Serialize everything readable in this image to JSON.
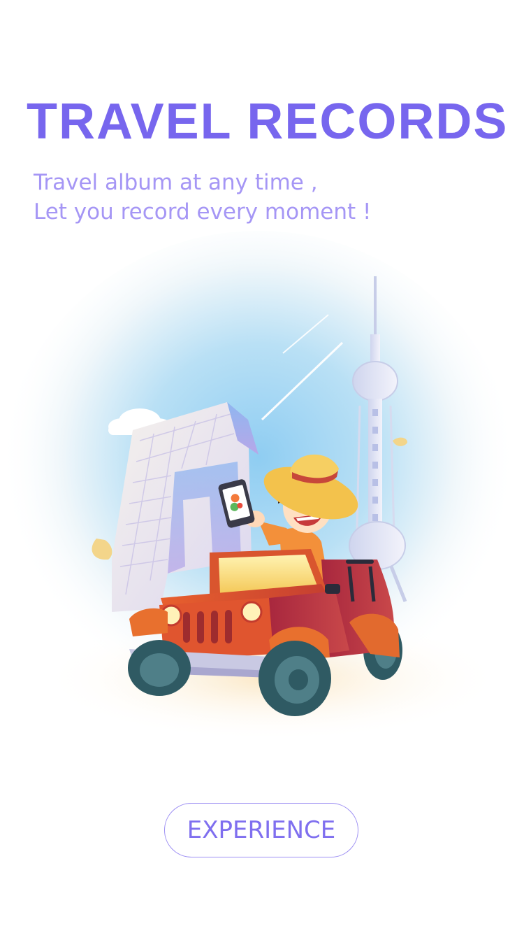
{
  "onboarding": {
    "title": "TRAVEL RECORDS",
    "subtitle_line1": "Travel album at any time ,",
    "subtitle_line2": "Let you record every moment !",
    "cta_label": "EXPERIENCE"
  },
  "illustration": {
    "subject": "boy-in-straw-hat-driving-jeep-with-phone",
    "landmarks": [
      "cctv-tower-icon",
      "tv-tower-icon"
    ]
  },
  "colors": {
    "accent": "#7766ee",
    "subtitle": "#a596f5",
    "button_border": "#9d8ff3",
    "sky": "#a9d9f5",
    "jeep_red": "#d9552e",
    "jeep_dark_red": "#a8273e",
    "hat_yellow": "#f3c24c",
    "shirt_orange": "#f3903a"
  }
}
